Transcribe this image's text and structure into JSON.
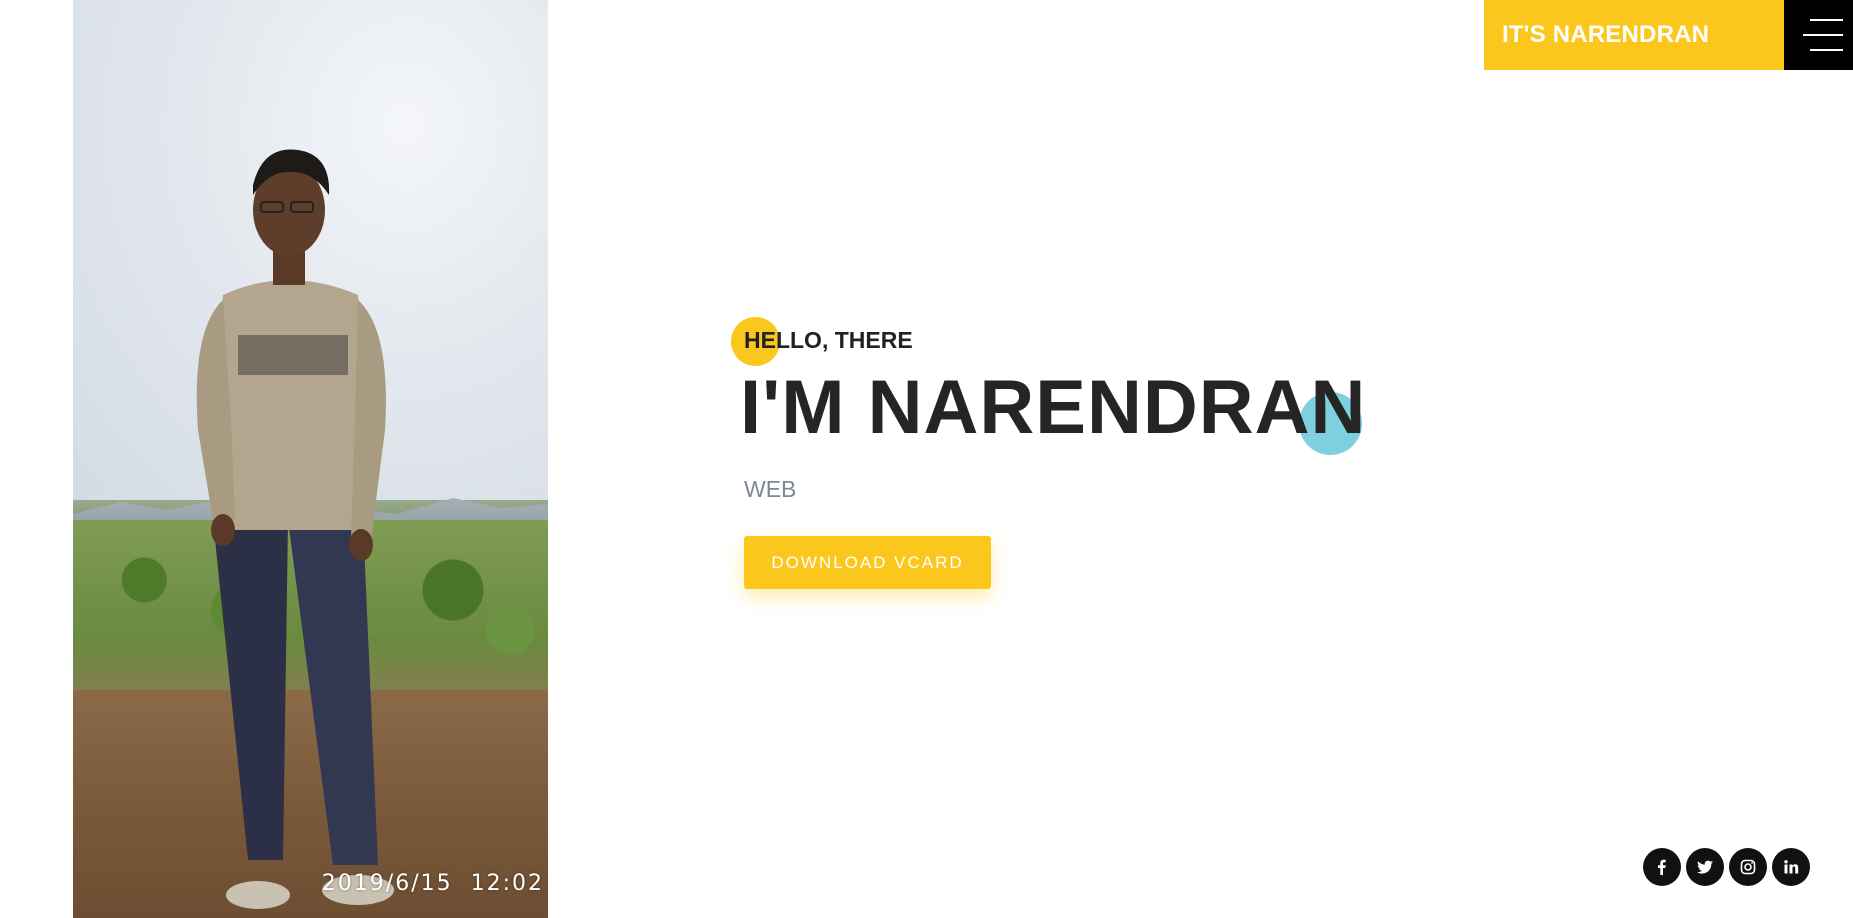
{
  "header": {
    "brand": "IT'S NARENDRAN",
    "menu_icon": "hamburger-menu-icon"
  },
  "hero": {
    "greeting": "HELLO, THERE",
    "headline": "I'M NARENDRAN",
    "role": "WEB",
    "cta_label": "DOWNLOAD VCARD"
  },
  "photo": {
    "timestamp": "2019/6/15  12:02"
  },
  "socials": [
    {
      "icon": "facebook-icon"
    },
    {
      "icon": "twitter-icon"
    },
    {
      "icon": "instagram-icon"
    },
    {
      "icon": "linkedin-icon"
    }
  ],
  "colors": {
    "accent": "#fcc71d",
    "accent_secondary": "#7ecfe0",
    "dark": "#000000",
    "text": "#252525",
    "muted": "#7d8896"
  }
}
